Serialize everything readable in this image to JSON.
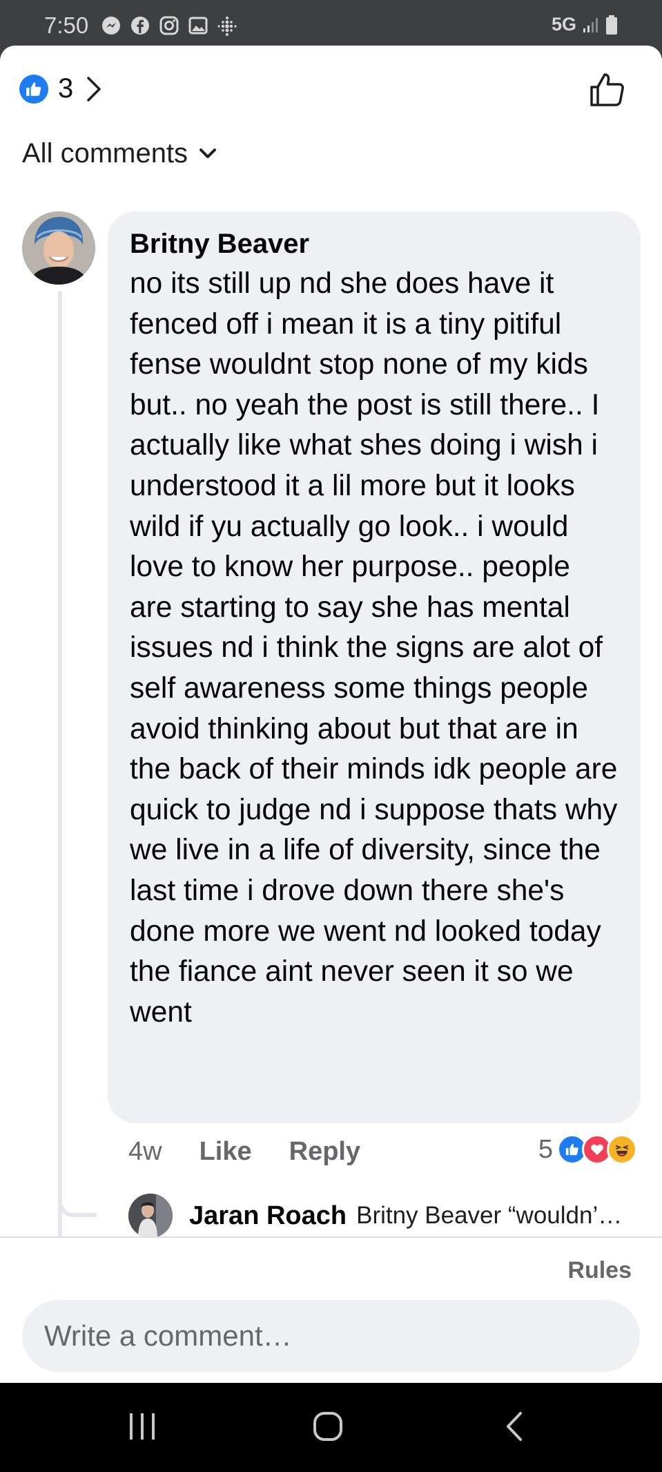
{
  "status_bar": {
    "time": "7:50",
    "network": "5G",
    "icons": [
      "messenger-icon",
      "facebook-icon",
      "instagram-icon",
      "gallery-icon",
      "fitbit-icon",
      "signal-icon",
      "battery-icon"
    ]
  },
  "header": {
    "reaction_type": "like",
    "reaction_count": "3",
    "like_button_icon": "thumbs-up-outline-icon"
  },
  "filter": {
    "label": "All comments"
  },
  "comment": {
    "author": "Britny Beaver",
    "text": "no its still up nd she does have it fenced off i mean it is a tiny pitiful fense wouldnt stop none of my kids but.. no yeah the post is still there.. I actually like what shes doing i wish i understood it a lil more but it looks wild if yu actually go look.. i would love to know her purpose.. people are starting to say she has mental issues nd i think the signs are alot of self awareness some things people avoid thinking about but that are in the back of their minds idk people are quick to judge nd i suppose thats why we live in a life of diversity, since the last time i drove down there she's done more we went nd looked today the fiance aint never seen it so we went",
    "time": "4w",
    "like_label": "Like",
    "reply_label": "Reply",
    "reaction_count": "5",
    "reactions": [
      "like",
      "love",
      "haha"
    ]
  },
  "reply": {
    "author": "Jaran Roach",
    "snippet": "Britny Beaver “wouldn’…"
  },
  "footer": {
    "rules_label": "Rules",
    "input_placeholder": "Write a comment…"
  },
  "colors": {
    "like_blue": "#1d7cf2",
    "love_red": "#f33e58",
    "haha_yellow": "#f7b125",
    "bubble_bg": "#eff0f4",
    "meta_gray": "#65676b"
  }
}
